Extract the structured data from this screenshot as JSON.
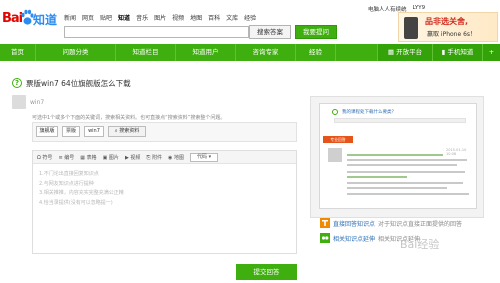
{
  "header": {
    "logo": {
      "bai": "Bai",
      "zhidao": "知道"
    },
    "nav_links": [
      "新闻",
      "网页",
      "贴吧",
      "知道",
      "音乐",
      "图片",
      "视频",
      "地图",
      "百科",
      "文库",
      "经验"
    ],
    "active_nav": "知道",
    "search_value": "",
    "answer_button": "搜索答案",
    "ask_button": "我要提问",
    "user_links": [
      "电脑人人有续统",
      "LYY9"
    ],
    "ad": {
      "title": "品非选关舍,",
      "subtitle": "赢取 iPhone 6s！"
    }
  },
  "green_nav": {
    "items": [
      "首页",
      "问题分类",
      "知道栏目",
      "知道用户",
      "咨询专家",
      "经验"
    ],
    "right_items": [
      "开放平台",
      "手机知道",
      "+"
    ]
  },
  "question": {
    "title": "票版win7 64位旗舰版怎么下载",
    "asker": "win7"
  },
  "tags": {
    "hint": "可选中1个或多个下面的关键词，搜索相关资料。也可直接点“搜索资料”搜索整个问题。",
    "items": [
      "旗舰版",
      "票版",
      "win7"
    ],
    "search_label": "搜索资料"
  },
  "editor": {
    "toolbar": [
      "符号",
      "编号",
      "表格",
      "图片",
      "视频",
      "附件",
      "地图"
    ],
    "code_label": "代码",
    "lines": [
      "1.不门论出直接回复知识点",
      "2.与网友知识点进行提种",
      "3.相关推推，内容充实完整充满公正精",
      "4.恰当录提供(没有可以忽略提一)"
    ],
    "submit": "提交回答"
  },
  "right_panel": {
    "mock_question": "我的课程处下载什么要类？",
    "mock_badge": "专业回答",
    "mock_time": "2015-01-10 10:08"
  },
  "features": [
    {
      "main": "直接回答知识点",
      "sub": "对于知识点直接正面提供的回答"
    },
    {
      "main": "相关知识点延伸",
      "sub": "相关知识点延伸"
    }
  ],
  "watermark": "Bai经验"
}
